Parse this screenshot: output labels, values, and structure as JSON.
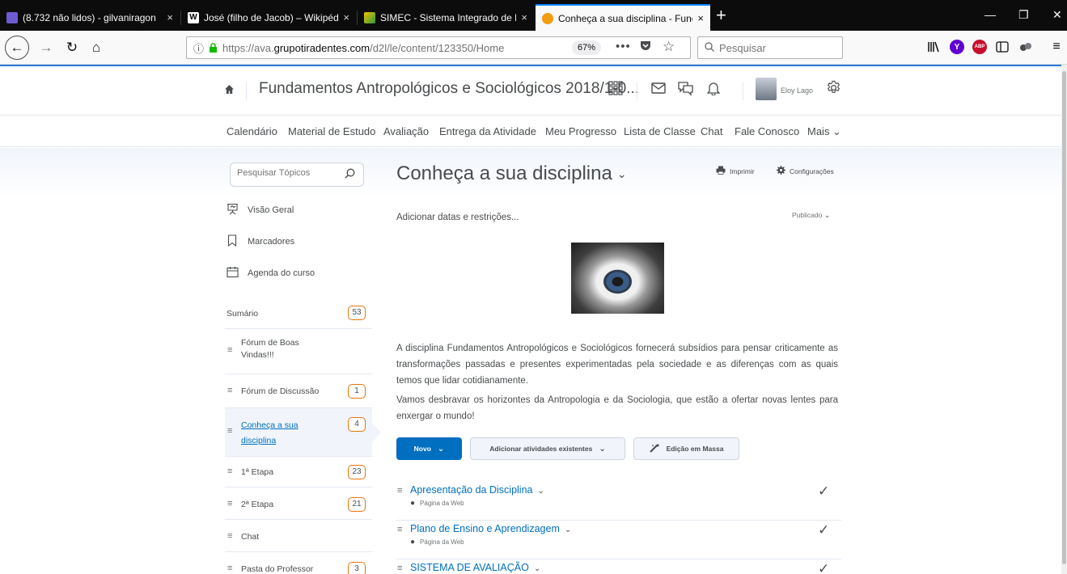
{
  "browser": {
    "tabs": [
      {
        "title": "(8.732 não lidos) - gilvaniragon",
        "close": "×"
      },
      {
        "title": "José (filho de Jacob) – Wikipédi",
        "close": "×"
      },
      {
        "title": "SIMEC - Sistema Integrado de P",
        "close": "×"
      },
      {
        "title": "Conheça a sua disciplina - Func",
        "close": "×"
      }
    ],
    "new_tab": "+",
    "window_controls": {
      "minimize": "—",
      "restore": "❐",
      "close": "✕"
    },
    "nav": {
      "back": "←",
      "forward": "→",
      "reload": "↻",
      "home": "⌂"
    },
    "url_prefix": "https://ava.",
    "url_domain": "grupotiradentes.com",
    "url_path": "/d2l/le/content/123350/Home",
    "zoom": "67%",
    "search_placeholder": "Pesquisar",
    "toolbar_icons": [
      "library-icon",
      "yahoo-icon",
      "adblock-icon",
      "reader-view-icon",
      "extension-icon",
      "menu-icon"
    ]
  },
  "header": {
    "course_title": "Fundamentos Antropológicos e Sociológicos 2018/1-0...",
    "user_name": "Eloy Lago",
    "accent": "#2b7bd8"
  },
  "nav_items": [
    "Calendário",
    "Material de Estudo",
    "Avaliação",
    "Entrega da Atividade",
    "Meu Progresso",
    "Lista de Classe",
    "Chat",
    "Fale Conosco",
    "Mais ⌄"
  ],
  "sidebar": {
    "search_placeholder": "Pesquisar Tópicos",
    "top_items": [
      {
        "label": "Visão Geral",
        "icon": "presentation-icon"
      },
      {
        "label": "Marcadores",
        "icon": "bookmark-icon"
      },
      {
        "label": "Agenda do curso",
        "icon": "calendar-icon"
      }
    ],
    "summary": {
      "label": "Sumário",
      "count": "53"
    },
    "modules": [
      {
        "label": "Fórum de Boas Vindas!!!",
        "count": ""
      },
      {
        "label": "Fórum de Discussão",
        "count": "1"
      },
      {
        "label": "Conheça a sua disciplina",
        "count": "4"
      },
      {
        "label": "1ª Etapa",
        "count": "23"
      },
      {
        "label": "2ª Etapa",
        "count": "21"
      },
      {
        "label": "Chat",
        "count": ""
      },
      {
        "label": "Pasta do Professor",
        "count": "3"
      }
    ]
  },
  "main": {
    "title": "Conheça a sua disciplina",
    "print_label": "Imprimir",
    "settings_label": "Configurações",
    "add_dates_label": "Adicionar datas e restrições...",
    "published_label": "Publicado",
    "paragraph1": "A disciplina Fundamentos Antropológicos e Sociológicos fornecerá subsídios para pensar criticamente as transformações passadas e presentes experimentadas pela sociedade e as diferenças com as quais temos que lidar cotidianamente.",
    "paragraph2": "Vamos desbravar os horizontes da Antropologia e da Sociologia, que estão a ofertar novas lentes para enxergar o mundo!",
    "buttons": {
      "new": "Novo",
      "add_existing": "Adicionar atividades existentes",
      "bulk_edit": "Edição em Massa"
    },
    "topics": [
      {
        "name": "Apresentação da Disciplina",
        "type": "Página da Web"
      },
      {
        "name": "Plano de Ensino e Aprendizagem",
        "type": "Página da Web"
      },
      {
        "name": "SISTEMA DE AVALIAÇÃO",
        "type": ""
      }
    ],
    "primary_color": "#006fbf",
    "badge_color": "#e87511"
  }
}
